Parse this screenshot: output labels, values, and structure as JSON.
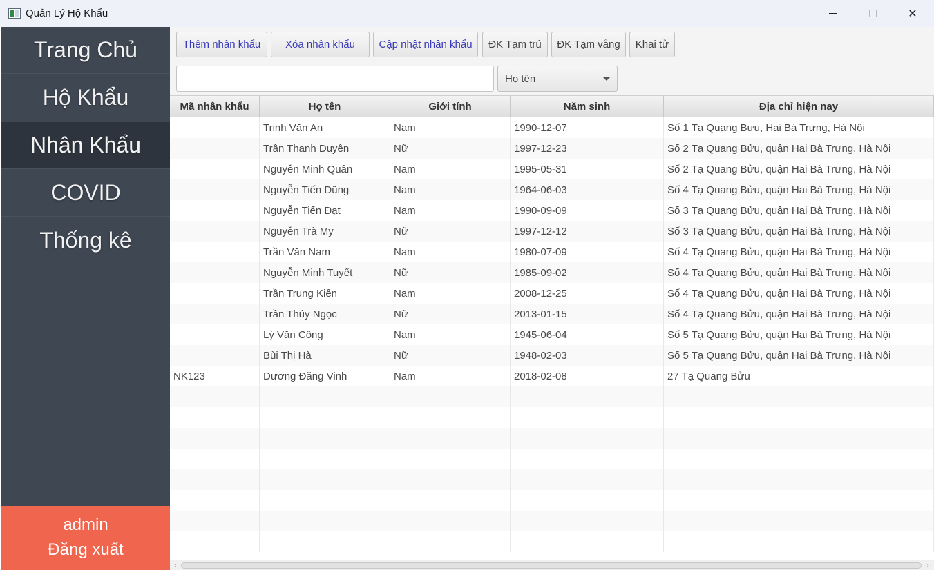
{
  "window": {
    "title": "Quản Lý Hộ Khẩu"
  },
  "sidebar": {
    "items": [
      {
        "label": "Trang Chủ"
      },
      {
        "label": "Hộ Khẩu"
      },
      {
        "label": "Nhân Khẩu",
        "active": true
      },
      {
        "label": "COVID"
      },
      {
        "label": "Thống kê"
      }
    ],
    "user": "admin",
    "logout_label": "Đăng xuất"
  },
  "toolbar": {
    "add": "Thêm nhân khẩu",
    "delete": "Xóa nhân khẩu",
    "update": "Cập nhật nhân khẩu",
    "temp_residence": "ĐK Tạm trú",
    "temp_absence": "ĐK Tạm vắng",
    "death": "Khai tử"
  },
  "search": {
    "value": "",
    "filter_selected": "Họ tên"
  },
  "table": {
    "columns": [
      "Mã nhân khẩu",
      "Họ tên",
      "Giới tính",
      "Năm sinh",
      "Địa chỉ hiện nay"
    ],
    "rows": [
      [
        "",
        "Trinh Văn An",
        "Nam",
        "1990-12-07",
        "Số 1 Tạ Quang Bưu, Hai Bà Trưng, Hà Nội"
      ],
      [
        "",
        "Trần Thanh Duyên",
        "Nữ",
        "1997-12-23",
        "Số 2 Tạ Quang Bửu, quận Hai Bà Trưng, Hà Nội"
      ],
      [
        "",
        "Nguyễn Minh Quân",
        "Nam",
        "1995-05-31",
        "Số 2 Tạ Quang Bửu, quận Hai Bà Trưng, Hà Nội"
      ],
      [
        "",
        "Nguyễn Tiến Dũng",
        "Nam",
        "1964-06-03",
        "Số 4 Tạ Quang Bửu, quận Hai Bà Trưng, Hà Nội"
      ],
      [
        "",
        "Nguyễn Tiến Đạt",
        "Nam",
        "1990-09-09",
        "Số 3 Tạ Quang Bửu, quận Hai Bà Trưng, Hà Nội"
      ],
      [
        "",
        "Nguyễn Trà My",
        "Nữ",
        "1997-12-12",
        "Số 3 Tạ Quang Bửu, quận Hai Bà Trưng, Hà Nội"
      ],
      [
        "",
        "Trần Văn Nam",
        "Nam",
        "1980-07-09",
        "Số 4 Tạ Quang Bửu, quận Hai Bà Trưng, Hà Nội"
      ],
      [
        "",
        "Nguyễn Minh Tuyết",
        "Nữ",
        "1985-09-02",
        "Số 4 Tạ Quang Bửu, quận Hai Bà Trưng, Hà Nội"
      ],
      [
        "",
        "Trần Trung Kiên",
        "Nam",
        "2008-12-25",
        "Số 4 Tạ Quang Bửu, quận Hai Bà Trưng, Hà Nội"
      ],
      [
        "",
        "Trần Thúy Ngọc",
        "Nữ",
        "2013-01-15",
        "Số 4 Tạ Quang Bửu, quận Hai Bà Trưng, Hà Nội"
      ],
      [
        "",
        "Lý Văn Công",
        "Nam",
        "1945-06-04",
        "Số 5 Tạ Quang Bửu, quận Hai Bà Trưng, Hà Nội"
      ],
      [
        "",
        "Bùi Thị Hà",
        "Nữ",
        "1948-02-03",
        "Số 5 Tạ Quang Bửu, quận Hai Bà Trưng, Hà Nội"
      ],
      [
        "NK123",
        "Dương Đăng Vinh",
        "Nam",
        "2018-02-08",
        "27 Tạ Quang Bửu"
      ]
    ]
  },
  "colors": {
    "sidebar_bg": "#3f4753",
    "sidebar_active": "#2e343d",
    "logout_bg": "#f0654e",
    "action_text": "#3a3ab8"
  }
}
